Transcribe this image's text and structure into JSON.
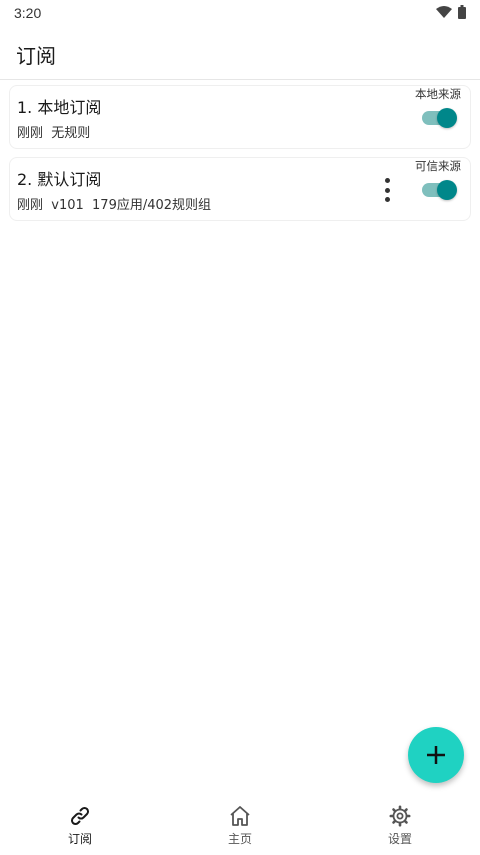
{
  "status_bar": {
    "time": "3:20"
  },
  "app_bar": {
    "title": "订阅"
  },
  "subscriptions": [
    {
      "title": "1. 本地订阅",
      "desc": "刚刚  无规则",
      "tag": "本地来源",
      "enabled": true
    },
    {
      "title": "2. 默认订阅",
      "desc": "刚刚  v101  179应用/402规则组",
      "tag": "可信来源",
      "enabled": true
    }
  ],
  "bottom_nav": [
    {
      "label": "订阅",
      "icon": "link-icon",
      "active": true
    },
    {
      "label": "主页",
      "icon": "home-icon",
      "active": false
    },
    {
      "label": "设置",
      "icon": "gear-icon",
      "active": false
    }
  ],
  "colors": {
    "accent": "#00878a",
    "toggle_track": "#7fbfbd",
    "fab": "#1fd2c2"
  },
  "fab": {
    "icon": "plus-icon"
  }
}
